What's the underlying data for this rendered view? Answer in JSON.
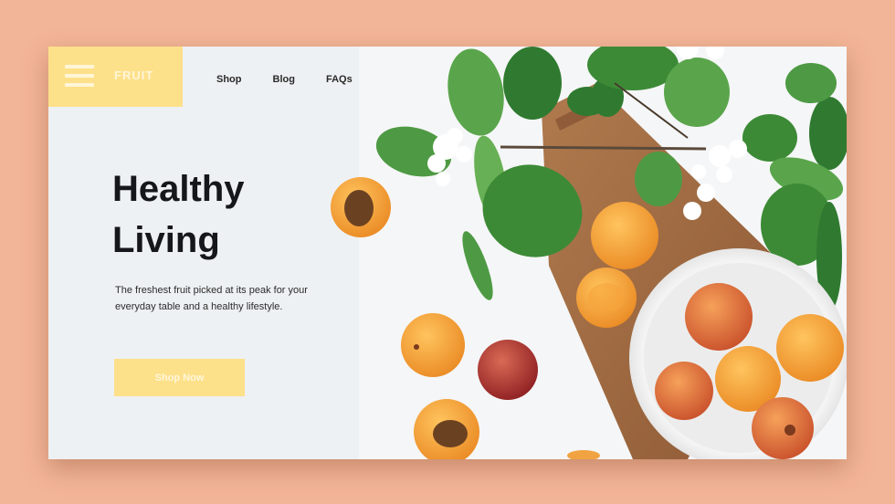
{
  "brand": {
    "name": "FRUIT"
  },
  "nav": {
    "items": [
      "Shop",
      "Blog",
      "FAQs"
    ]
  },
  "hero": {
    "title_line1": "Healthy",
    "title_line2": "Living",
    "description": "The freshest fruit picked at its peak for your everyday table and a healthy lifestyle.",
    "cta_label": "Shop Now"
  },
  "colors": {
    "background": "#f3b597",
    "accent": "#fde08a",
    "text": "#15171c"
  }
}
